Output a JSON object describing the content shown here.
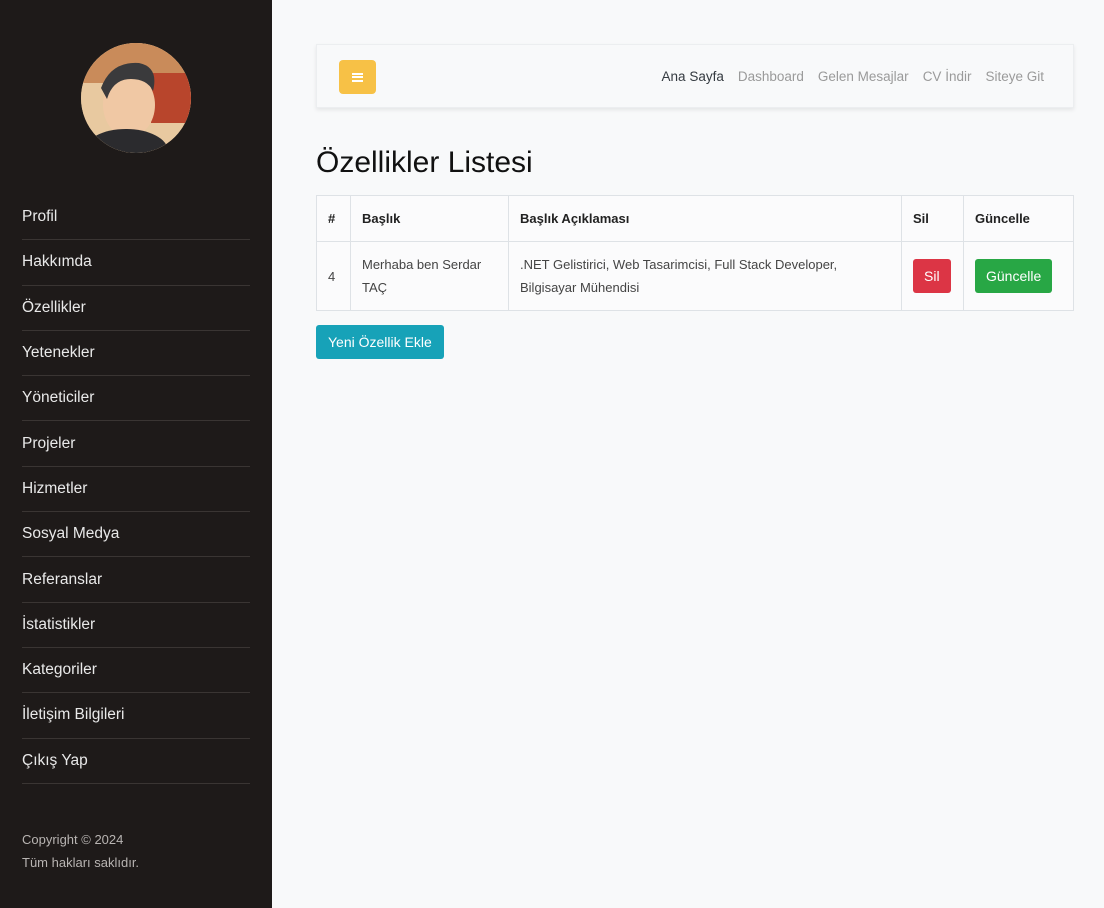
{
  "sidebar": {
    "items": [
      {
        "label": "Profil"
      },
      {
        "label": "Hakkımda"
      },
      {
        "label": "Özellikler"
      },
      {
        "label": "Yetenekler"
      },
      {
        "label": "Yöneticiler"
      },
      {
        "label": "Projeler"
      },
      {
        "label": "Hizmetler"
      },
      {
        "label": "Sosyal Medya"
      },
      {
        "label": "Referanslar"
      },
      {
        "label": "İstatistikler"
      },
      {
        "label": "Kategoriler"
      },
      {
        "label": "İletişim Bilgileri"
      },
      {
        "label": "Çıkış Yap"
      }
    ],
    "copyright_line1": "Copyright © 2024",
    "copyright_line2": "Tüm hakları saklıdır."
  },
  "topbar": {
    "links": [
      {
        "label": "Ana Sayfa"
      },
      {
        "label": "Dashboard"
      },
      {
        "label": "Gelen Mesajlar"
      },
      {
        "label": "CV İndir"
      },
      {
        "label": "Siteye Git"
      }
    ],
    "toggle_icon": "hamburger-icon"
  },
  "main": {
    "title": "Özellikler Listesi",
    "table": {
      "headers": [
        "#",
        "Başlık",
        "Başlık Açıklaması",
        "Sil",
        "Güncelle"
      ],
      "rows": [
        {
          "id": "4",
          "title": "Merhaba ben Serdar TAÇ",
          "description": ".NET Gelistirici, Web Tasarimcisi, Full Stack Developer, Bilgisayar Mühendisi",
          "delete_label": "Sil",
          "update_label": "Güncelle"
        }
      ]
    },
    "add_button_label": "Yeni Özellik Ekle"
  },
  "colors": {
    "sidebar_bg": "#1e1a19",
    "toggle": "#f7c146",
    "danger": "#dc3545",
    "success": "#28a745",
    "info": "#17a2b8"
  }
}
